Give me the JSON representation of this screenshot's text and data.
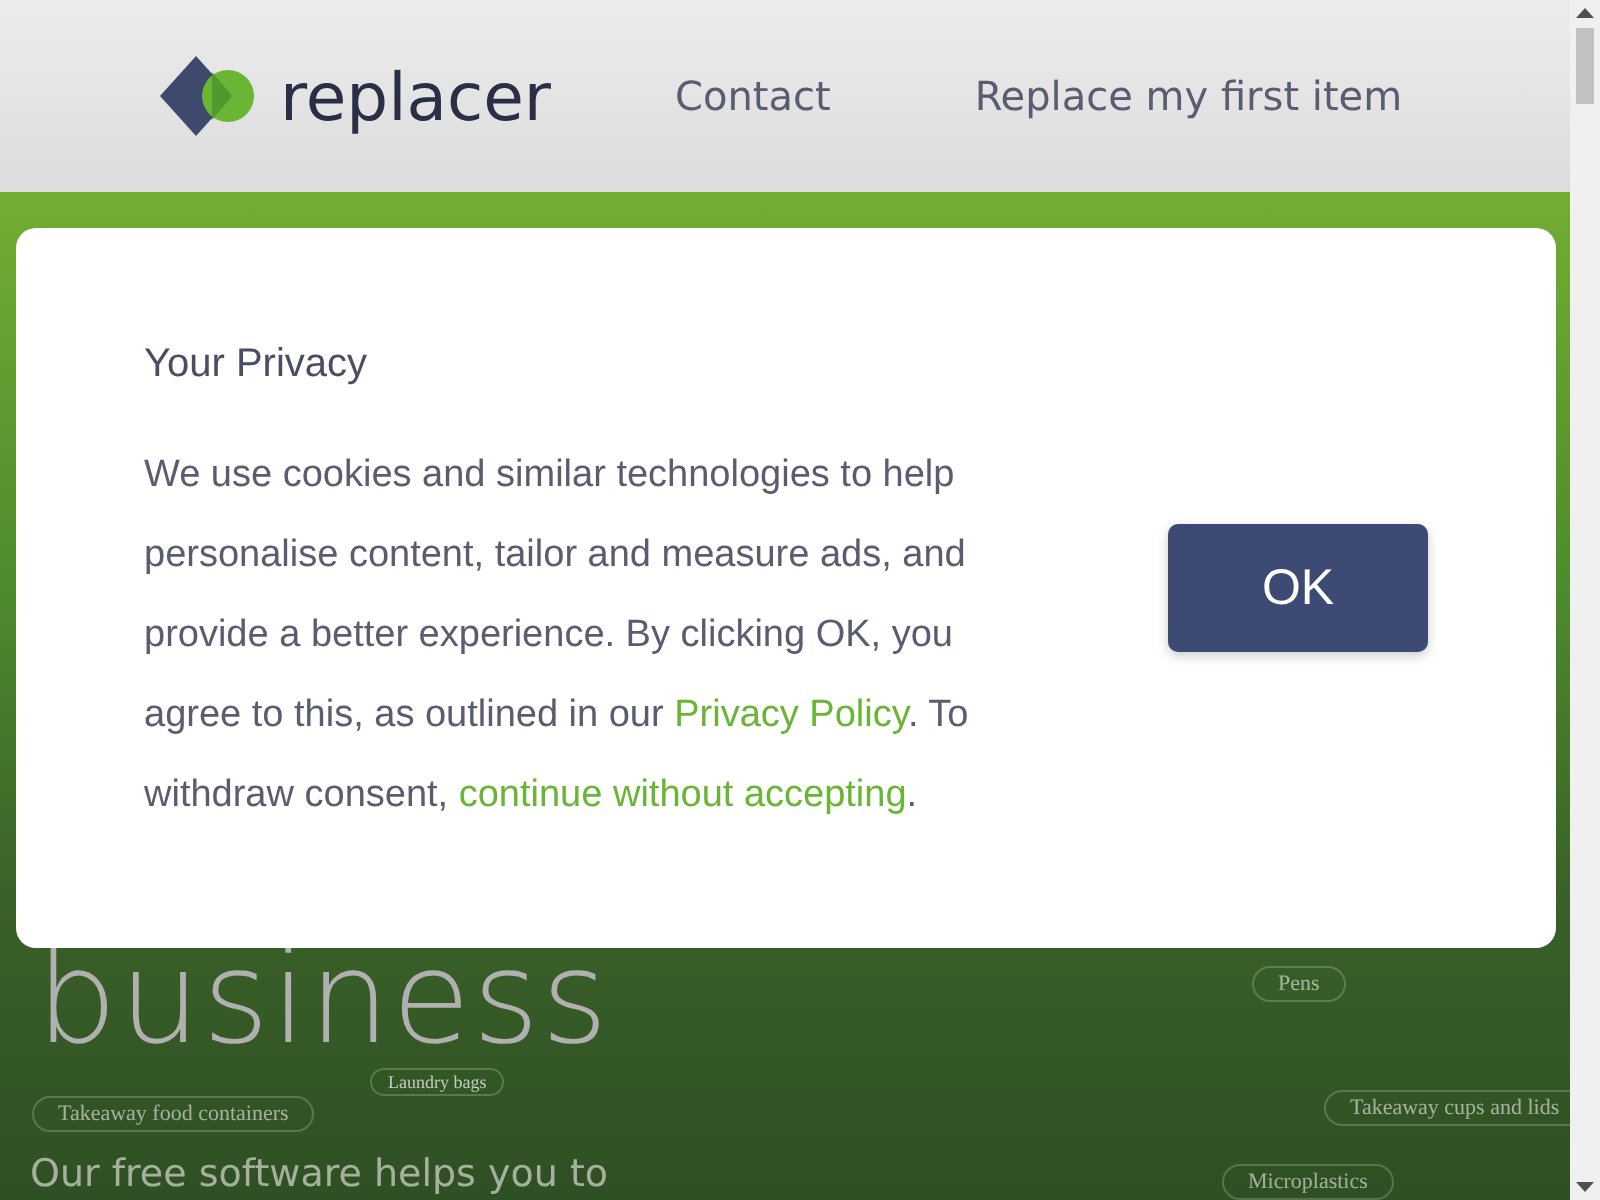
{
  "header": {
    "logo_text": "replacer",
    "nav": [
      "Contact",
      "Replace my first item"
    ]
  },
  "hero": {
    "headline_fragment": "business",
    "subtitle": "Our free software helps you to",
    "tags": [
      {
        "label": "Laundry bags",
        "kind": "tiny"
      },
      {
        "label": "Pens",
        "kind": "normal"
      },
      {
        "label": "Takeaway food containers",
        "kind": "normal"
      },
      {
        "label": "Takeaway cups and lids",
        "kind": "normal"
      },
      {
        "label": "Microplastics",
        "kind": "normal"
      }
    ]
  },
  "dialog": {
    "title": "Your Privacy",
    "body_parts": [
      {
        "text": "We use cookies and similar technologies to help personalise content, tailor and measure ads, and provide a better experience. By clicking OK, you agree to this, as outlined in our ",
        "kind": "text"
      },
      {
        "text": "Privacy Policy",
        "kind": "link"
      },
      {
        "text": ". To withdraw consent, ",
        "kind": "text"
      },
      {
        "text": "continue without accepting",
        "kind": "link"
      },
      {
        "text": ".",
        "kind": "text"
      }
    ],
    "button": "OK"
  }
}
